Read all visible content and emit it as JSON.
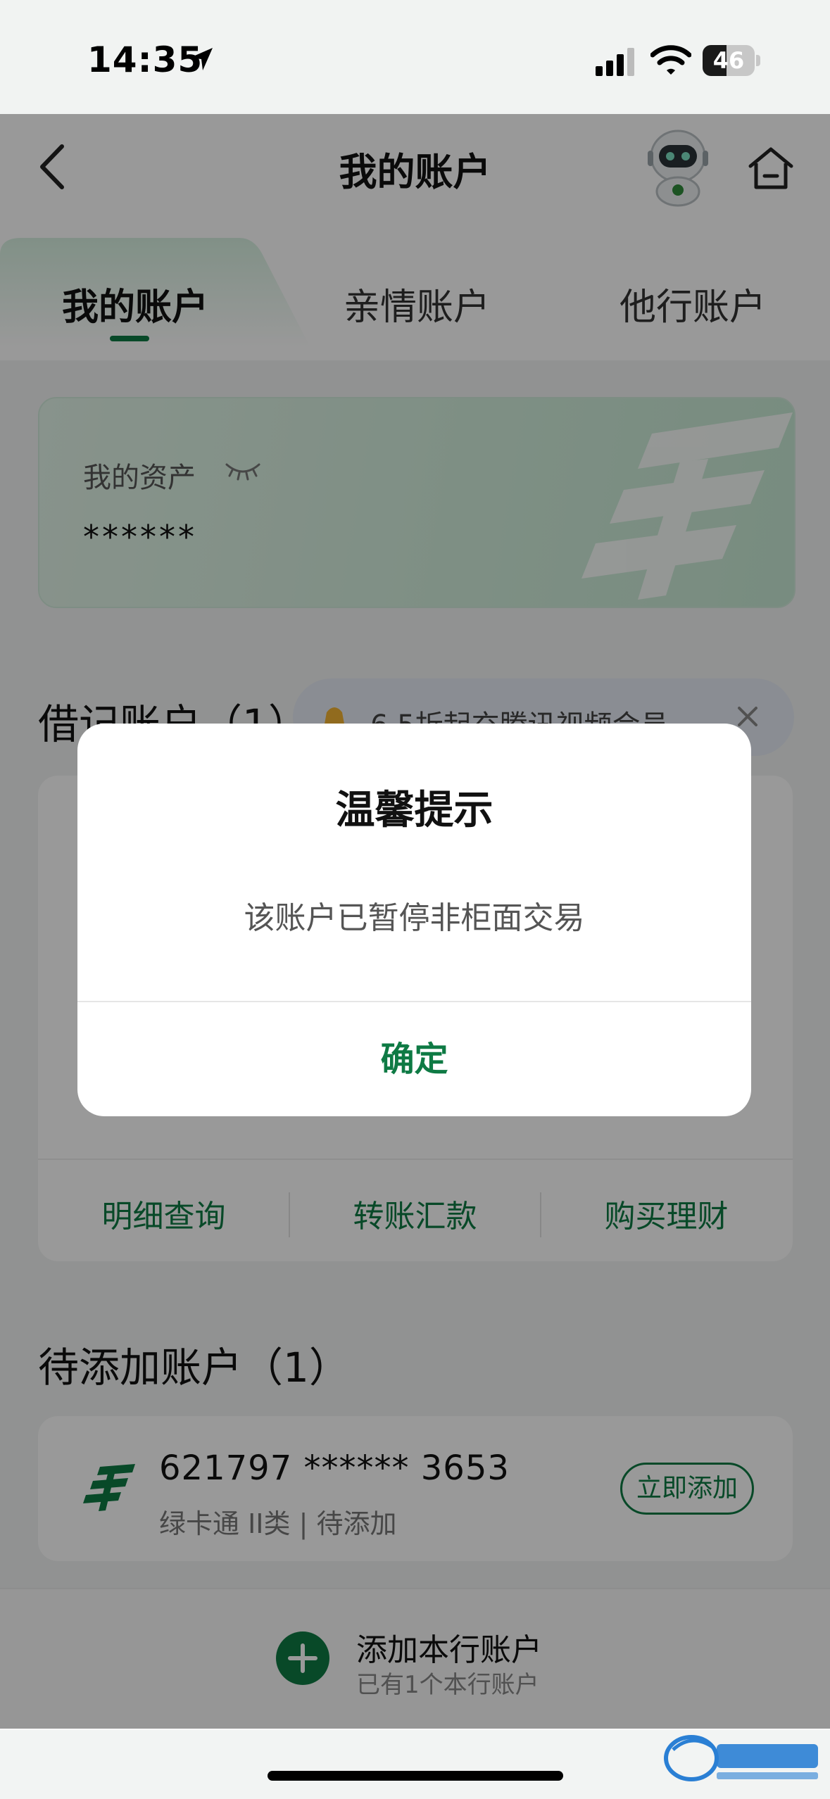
{
  "status_bar": {
    "time": "14:35",
    "battery": "46",
    "battery_level": 0.46
  },
  "nav": {
    "title": "我的账户"
  },
  "tabs": [
    {
      "label": "我的账户",
      "active": true
    },
    {
      "label": "亲情账户",
      "active": false
    },
    {
      "label": "他行账户",
      "active": false
    }
  ],
  "assets": {
    "label": "我的资产",
    "value": "******"
  },
  "debit_section": {
    "title": "借记账户（1）"
  },
  "promo": {
    "text": "6.5折起充腾讯视频会员"
  },
  "account_actions": [
    "明细查询",
    "转账汇款",
    "购买理财"
  ],
  "pending_section": {
    "title": "待添加账户（1）"
  },
  "pending_account": {
    "number": "621797 ****** 3653",
    "subtitle": "绿卡通 II类 | 待添加",
    "add_button": "立即添加"
  },
  "bottom_bar": {
    "label": "添加本行账户",
    "sub": "已有1个本行账户"
  },
  "dialog": {
    "title": "温馨提示",
    "message": "该账户已暂停非柜面交易",
    "confirm": "确定"
  },
  "colors": {
    "accent": "#0e7a44",
    "overlay": "rgba(0,0,0,0.40)"
  }
}
